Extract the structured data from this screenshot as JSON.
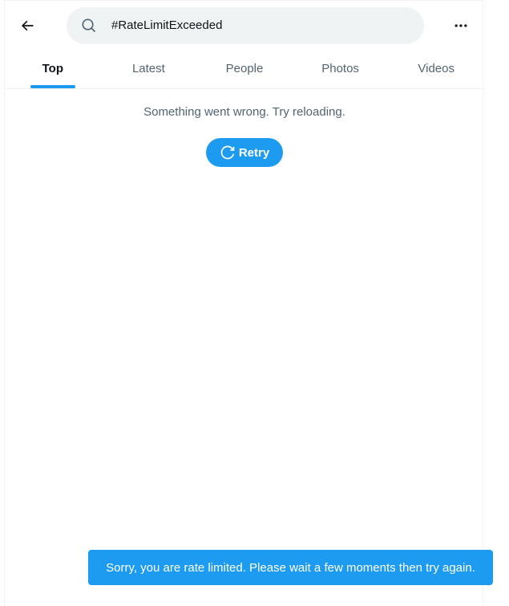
{
  "header": {
    "search": {
      "value": "#RateLimitExceeded"
    }
  },
  "tabs": [
    {
      "label": "Top",
      "active": true
    },
    {
      "label": "Latest",
      "active": false
    },
    {
      "label": "People",
      "active": false
    },
    {
      "label": "Photos",
      "active": false
    },
    {
      "label": "Videos",
      "active": false
    }
  ],
  "main": {
    "error_message": "Something went wrong. Try reloading.",
    "retry_label": "Retry"
  },
  "toast": {
    "message": "Sorry, you are rate limited. Please wait a few moments then try again."
  },
  "colors": {
    "accent": "#1d9bf0",
    "text_primary": "#0f1419",
    "text_secondary": "#536471",
    "search_bg": "#eff3f4"
  },
  "icons": {
    "back": "back-arrow-icon",
    "search": "search-icon",
    "more": "more-icon",
    "retry": "refresh-icon"
  }
}
